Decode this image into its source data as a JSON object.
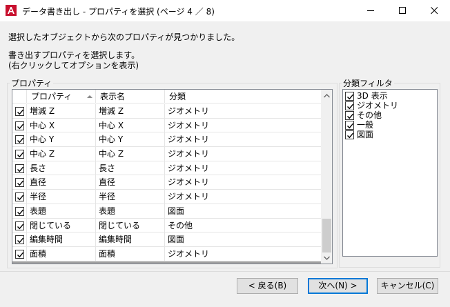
{
  "window": {
    "title": "データ書き出し - プロパティを選択 (ページ 4 ／ 8)",
    "accent_color": "#c8102e"
  },
  "intro": {
    "line1": "選択したオブジェクトから次のプロパティが見つかりました。",
    "line2": "書き出すプロパティを選択します。",
    "line3": "(右クリックしてオプションを表示)"
  },
  "properties": {
    "group_label": "プロパティ",
    "columns": [
      "プロパティ",
      "表示名",
      "分類"
    ],
    "rows": [
      {
        "checked": true,
        "property": "増減 Z",
        "display": "増減 Z",
        "category": "ジオメトリ"
      },
      {
        "checked": true,
        "property": "中心 X",
        "display": "中心 X",
        "category": "ジオメトリ"
      },
      {
        "checked": true,
        "property": "中心 Y",
        "display": "中心 Y",
        "category": "ジオメトリ"
      },
      {
        "checked": true,
        "property": "中心 Z",
        "display": "中心 Z",
        "category": "ジオメトリ"
      },
      {
        "checked": true,
        "property": "長さ",
        "display": "長さ",
        "category": "ジオメトリ"
      },
      {
        "checked": true,
        "property": "直径",
        "display": "直径",
        "category": "ジオメトリ"
      },
      {
        "checked": true,
        "property": "半径",
        "display": "半径",
        "category": "ジオメトリ"
      },
      {
        "checked": true,
        "property": "表題",
        "display": "表題",
        "category": "図面"
      },
      {
        "checked": true,
        "property": "閉じている",
        "display": "閉じている",
        "category": "その他"
      },
      {
        "checked": true,
        "property": "編集時間",
        "display": "編集時間",
        "category": "図面"
      },
      {
        "checked": true,
        "property": "面積",
        "display": "面積",
        "category": "ジオメトリ"
      }
    ]
  },
  "filter": {
    "group_label": "分類フィルタ",
    "items": [
      {
        "checked": true,
        "label": "3D 表示"
      },
      {
        "checked": true,
        "label": "ジオメトリ"
      },
      {
        "checked": true,
        "label": "その他"
      },
      {
        "checked": true,
        "label": "一般"
      },
      {
        "checked": true,
        "label": "図面"
      }
    ]
  },
  "buttons": {
    "back": "< 戻る(B)",
    "next": "次へ(N) >",
    "cancel": "キャンセル(C)"
  }
}
